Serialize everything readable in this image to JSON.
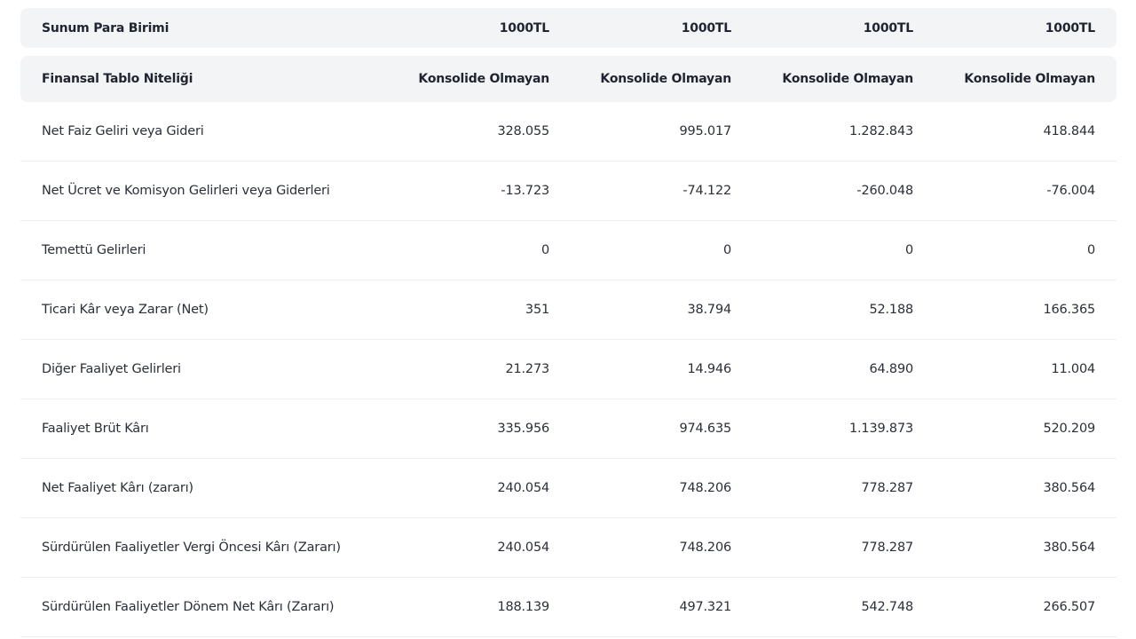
{
  "header": {
    "currency": {
      "label": "Sunum Para Birimi",
      "values": [
        "1000TL",
        "1000TL",
        "1000TL",
        "1000TL"
      ]
    },
    "nature": {
      "label": "Finansal Tablo Niteliği",
      "values": [
        "Konsolide Olmayan",
        "Konsolide Olmayan",
        "Konsolide Olmayan",
        "Konsolide Olmayan"
      ]
    }
  },
  "rows": [
    {
      "label": "Net Faiz Geliri veya Gideri",
      "values": [
        "328.055",
        "995.017",
        "1.282.843",
        "418.844"
      ]
    },
    {
      "label": "Net Ücret ve Komisyon Gelirleri veya Giderleri",
      "values": [
        "-13.723",
        "-74.122",
        "-260.048",
        "-76.004"
      ]
    },
    {
      "label": "Temettü Gelirleri",
      "values": [
        "0",
        "0",
        "0",
        "0"
      ]
    },
    {
      "label": "Ticari Kâr veya Zarar (Net)",
      "values": [
        "351",
        "38.794",
        "52.188",
        "166.365"
      ]
    },
    {
      "label": "Diğer Faaliyet Gelirleri",
      "values": [
        "21.273",
        "14.946",
        "64.890",
        "11.004"
      ]
    },
    {
      "label": "Faaliyet Brüt Kârı",
      "values": [
        "335.956",
        "974.635",
        "1.139.873",
        "520.209"
      ]
    },
    {
      "label": "Net Faaliyet Kârı (zararı)",
      "values": [
        "240.054",
        "748.206",
        "778.287",
        "380.564"
      ]
    },
    {
      "label": "Sürdürülen Faaliyetler Vergi Öncesi Kârı (Zararı)",
      "values": [
        "240.054",
        "748.206",
        "778.287",
        "380.564"
      ]
    },
    {
      "label": "Sürdürülen Faaliyetler Dönem Net Kârı (Zararı)",
      "values": [
        "188.139",
        "497.321",
        "542.748",
        "266.507"
      ]
    }
  ]
}
